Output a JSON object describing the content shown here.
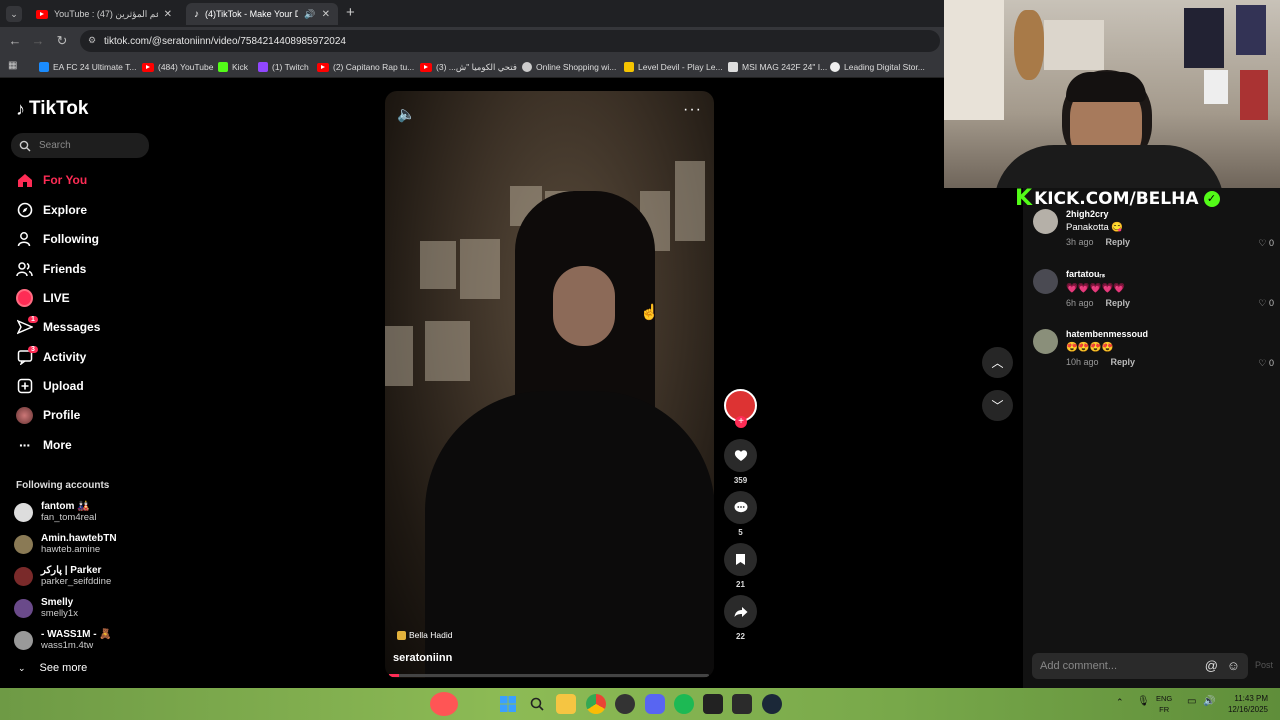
{
  "browser": {
    "tabs": [
      {
        "title": "YouTube : مطاعم المؤثرين (47)",
        "close": "✕"
      },
      {
        "title": "(4)TikTok - Make Your Day",
        "close": "✕"
      }
    ],
    "new_tab": "+",
    "url": "tiktok.com/@seratoniinn/video/7584214408985972024",
    "bookmarks": [
      "EA FC 24 Ultimate T...",
      "(484) YouTube",
      "Kick",
      "(1) Twitch",
      "(2) Capitano Rap tu...",
      "فتحي الكوميا \"ش... (3)",
      "Online Shopping wi...",
      "Level Devil - Play Le...",
      "MSI MAG 242F 24\" I...",
      "Leading Digital Stor..."
    ]
  },
  "tiktok": {
    "logo": "TikTok",
    "search_placeholder": "Search",
    "nav": [
      {
        "label": "For You",
        "icon": "home-icon",
        "active": true
      },
      {
        "label": "Explore",
        "icon": "compass-icon"
      },
      {
        "label": "Following",
        "icon": "user-icon"
      },
      {
        "label": "Friends",
        "icon": "users-icon"
      },
      {
        "label": "LIVE",
        "icon": "live-icon"
      },
      {
        "label": "Messages",
        "icon": "send-icon",
        "badge": "1"
      },
      {
        "label": "Activity",
        "icon": "activity-icon",
        "badge": "3"
      },
      {
        "label": "Upload",
        "icon": "plus-square-icon"
      },
      {
        "label": "Profile",
        "icon": "profile-avatar"
      },
      {
        "label": "More",
        "icon": "more-icon"
      }
    ],
    "following_title": "Following accounts",
    "following": [
      {
        "name": "fantom 🎎",
        "handle": "fan_tom4real"
      },
      {
        "name": "Amin.hawtebTN",
        "handle": "hawteb.amine"
      },
      {
        "name": "پارکر | Parker",
        "handle": "parker_seifddine"
      },
      {
        "name": "Smelly",
        "handle": "smelly1x"
      },
      {
        "name": "- WASS1M - 🧸",
        "handle": "wass1m.4tw"
      }
    ],
    "see_more": "See more",
    "video": {
      "music": "Bella Hadid",
      "author": "seratoniinn",
      "progress": 0.03
    },
    "actions": {
      "likes": "359",
      "comments": "5",
      "saves": "21",
      "shares": "22"
    },
    "comments": [
      {
        "user": "2high2cry",
        "text": "Panakotta 😋",
        "time": "3h ago",
        "reply": "Reply",
        "likes": "0"
      },
      {
        "user": "fartatouᵣₛ",
        "text": "💗💗💗💗💗",
        "time": "6h ago",
        "reply": "Reply",
        "likes": "0"
      },
      {
        "user": "hatembenmessoud",
        "text": "😍😍😍😍",
        "time": "10h ago",
        "reply": "Reply",
        "likes": "0"
      }
    ],
    "add_comment_placeholder": "Add comment...",
    "post_label": "Post"
  },
  "overlay": {
    "kick_text": "KICK.COM/BELHA"
  },
  "taskbar": {
    "lang_top": "ENG",
    "lang_bottom": "FR",
    "time": "11:43 PM",
    "date": "12/16/2025"
  },
  "colors": {
    "accent": "#fe2c55",
    "kick_green": "#53fc18"
  }
}
